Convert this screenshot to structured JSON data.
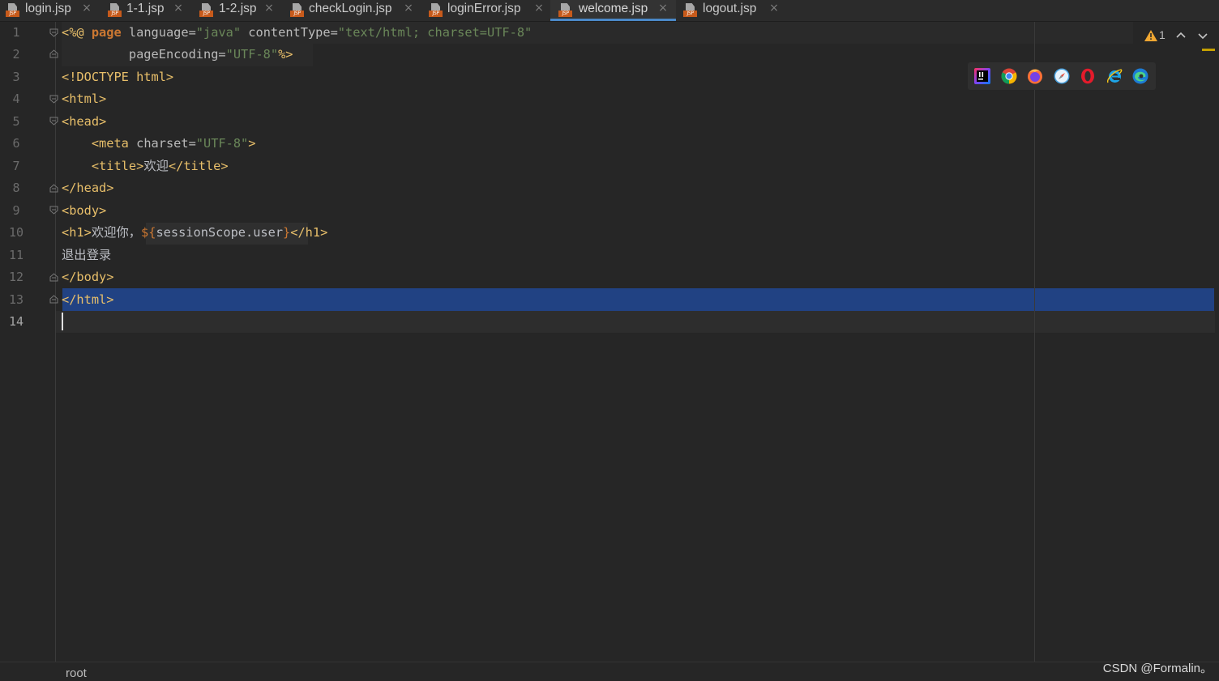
{
  "tabs": [
    {
      "label": "login.jsp",
      "icon": "jsp-file-icon",
      "active": false
    },
    {
      "label": "1-1.jsp",
      "icon": "jsp-file-icon",
      "active": false
    },
    {
      "label": "1-2.jsp",
      "icon": "jsp-file-icon",
      "active": false
    },
    {
      "label": "checkLogin.jsp",
      "icon": "jsp-file-icon",
      "active": false
    },
    {
      "label": "loginError.jsp",
      "icon": "jsp-file-icon",
      "active": false
    },
    {
      "label": "welcome.jsp",
      "icon": "jsp-file-icon",
      "active": true
    },
    {
      "label": "logout.jsp",
      "icon": "jsp-file-icon",
      "active": false
    }
  ],
  "file_icon_label": "JSP",
  "close_glyph": "×",
  "line_numbers": [
    "1",
    "2",
    "3",
    "4",
    "5",
    "6",
    "7",
    "8",
    "9",
    "10",
    "11",
    "12",
    "13",
    "14"
  ],
  "code": {
    "l1": {
      "open": "<%@ ",
      "kw": "page",
      "a1": " language=",
      "v1": "\"java\"",
      "a2": " contentType=",
      "v2": "\"text/html; charset=UTF-8\""
    },
    "l2": {
      "indent": "         ",
      "a1": "pageEncoding=",
      "v1": "\"UTF-8\"",
      "close": "%>"
    },
    "l3": {
      "text": "<!DOCTYPE html>"
    },
    "l4": {
      "text": "<html>"
    },
    "l5": {
      "text": "<head>"
    },
    "l6": {
      "indent": "    ",
      "open": "<meta",
      "a1": " charset=",
      "v1": "\"UTF-8\"",
      "close": ">"
    },
    "l7": {
      "indent": "    ",
      "open": "<title>",
      "body": "欢迎",
      "close": "</title>"
    },
    "l8": {
      "text": "</head>"
    },
    "l9": {
      "text": "<body>"
    },
    "l10": {
      "open": "<h1>",
      "body": "欢迎你，",
      "el_open": "${",
      "el_body": "sessionScope.user",
      "el_close": "}",
      "close": "</h1>"
    },
    "l11": {
      "text": "退出登录"
    },
    "l12": {
      "text": "</body>"
    },
    "l13": {
      "text": "</html>"
    },
    "l14": {
      "text": ""
    }
  },
  "inspections": {
    "warnings_count": "1",
    "icon": "warning-icon",
    "colors": {
      "warning": "#f0a732"
    }
  },
  "browsers": [
    "intellij-icon",
    "chrome-icon",
    "firefox-icon",
    "safari-icon",
    "opera-icon",
    "ie-icon",
    "edge-icon"
  ],
  "status": {
    "breadcrumb": "root",
    "watermark": "CSDN @Formalin。"
  },
  "colors": {
    "background": "#262626",
    "tag": "#e8bf6a",
    "string": "#6a8759",
    "keyword": "#cc7832",
    "selection": "#214283",
    "active_tab_underline": "#4a88c7",
    "jsp_icon": "#c75a1b"
  }
}
